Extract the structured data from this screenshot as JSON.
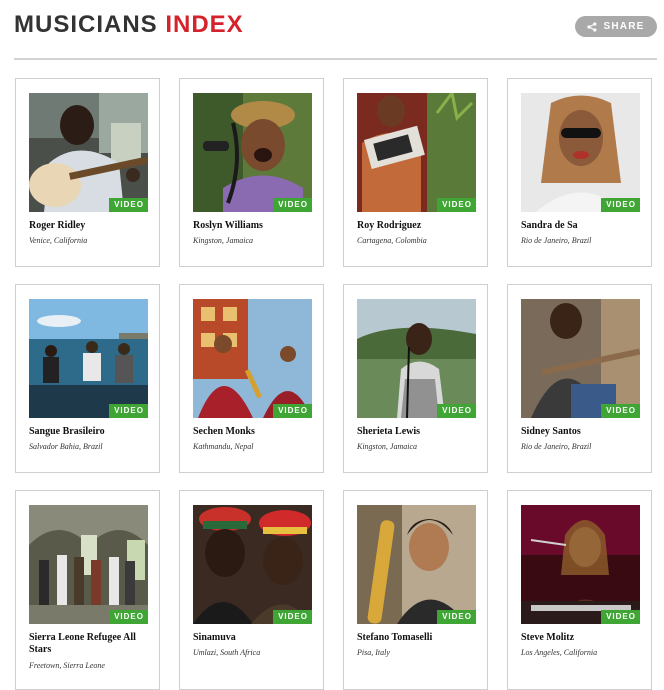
{
  "header": {
    "title_part1": "MUSICIANS",
    "title_part2": "INDEX",
    "share_label": "SHARE",
    "accent_color": "#d4232d"
  },
  "badge_label": "VIDEO",
  "musicians": [
    {
      "name": "Roger Ridley",
      "location": "Venice, California"
    },
    {
      "name": "Roslyn Williams",
      "location": "Kingston, Jamaica"
    },
    {
      "name": "Roy Rodriguez",
      "location": "Cartagena, Colombia"
    },
    {
      "name": "Sandra de Sa",
      "location": "Rio de Janeiro, Brazil"
    },
    {
      "name": "Sangue Brasileiro",
      "location": "Salvador Bahia, Brazil"
    },
    {
      "name": "Sechen Monks",
      "location": "Kathmandu, Nepal"
    },
    {
      "name": "Sherieta Lewis",
      "location": "Kingston, Jamaica"
    },
    {
      "name": "Sidney Santos",
      "location": "Rio de Janeiro, Brazil"
    },
    {
      "name": "Sierra Leone Refugee All Stars",
      "location": "Freetown, Sierra Leone"
    },
    {
      "name": "Sinamuva",
      "location": "Umlazi, South Africa"
    },
    {
      "name": "Stefano Tomaselli",
      "location": "Pisa, Italy"
    },
    {
      "name": "Steve Molitz",
      "location": "Los Angeles, California"
    }
  ]
}
